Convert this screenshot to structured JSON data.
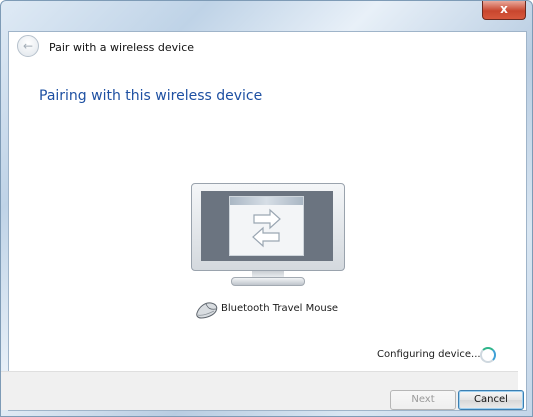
{
  "window": {
    "close_label": "x"
  },
  "dialog": {
    "title": "Pair with a wireless device",
    "heading": "Pairing with this wireless device",
    "device_name": "Bluetooth Travel Mouse",
    "status": "Configuring device..."
  },
  "buttons": {
    "next": "Next",
    "cancel": "Cancel"
  },
  "icons": {
    "back": "back-arrow-icon",
    "monitor": "monitor-illustration",
    "mouse": "mouse-icon",
    "spinner": "busy-spinner-icon",
    "close": "close-icon"
  }
}
